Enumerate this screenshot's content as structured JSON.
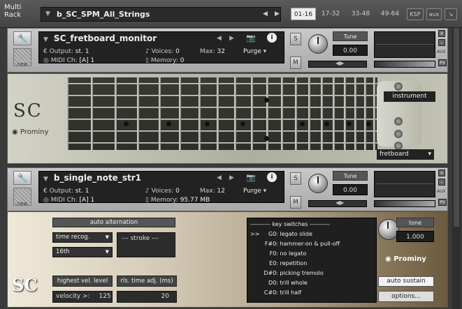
{
  "rack": {
    "label": "Multi Rack",
    "name": "b_SC_SPM_All_Strings",
    "tabs": [
      "01-16",
      "17-32",
      "33-48",
      "49-64"
    ],
    "active_tab": "01-16",
    "ksp_label": "KSP",
    "aux_label": "aux"
  },
  "instrument1": {
    "name": "SC_fretboard_monitor",
    "output_label": "Output:",
    "output": "st. 1",
    "voices_label": "Voices:",
    "voices": "0",
    "max_label": "Max:",
    "max": "32",
    "purge_label": "Purge",
    "midi_label": "MIDI Ch:",
    "midi": "[A]  1",
    "memory_label": "Memory:",
    "memory": "0",
    "tune_label": "Tune",
    "tune_value": "0.00",
    "solo": "S",
    "mute": "M"
  },
  "instrument2": {
    "name": "b_single_note_str1",
    "output_label": "Output:",
    "output": "st. 1",
    "voices_label": "Voices:",
    "voices": "0",
    "max_label": "Max:",
    "max": "12",
    "purge_label": "Purge",
    "midi_label": "MIDI Ch:",
    "midi": "[A]  1",
    "memory_label": "Memory:",
    "memory": "95.77 MB",
    "tune_label": "Tune",
    "tune_value": "0.00",
    "solo": "S",
    "mute": "M"
  },
  "side_labels": {
    "aux": "AUX",
    "pv": "PV",
    "new": "new"
  },
  "fretboard": {
    "logo_text": "SC",
    "brand": "Prominy",
    "instrument_label": "instrument",
    "view_select": "fretboard"
  },
  "controls": {
    "auto_alternation": "auto alternation",
    "time_recog": "time recog.",
    "note_value": "16th",
    "stroke": "--- stroke ---",
    "highest_vel_label": "highest vel. level",
    "rls_time_label": "rls. time adj. (ms)",
    "velocity_label": "velocity >:",
    "velocity_value": "125",
    "rls_time_value": "20",
    "tone_label": "tone",
    "tone_value": "1.000",
    "brand": "Prominy",
    "logo_text": "SC",
    "auto_sustain": "auto sustain",
    "options": "options..."
  },
  "key_switches": {
    "title": "---------- key switches ----------",
    "items": [
      {
        "marker": ">>",
        "key": "G0:",
        "label": "legato slide"
      },
      {
        "marker": "",
        "key": "F#0:",
        "label": "hammer-on & pull-off"
      },
      {
        "marker": "",
        "key": "F0:",
        "label": "no legato"
      },
      {
        "marker": "",
        "key": "E0:",
        "label": "repetition"
      },
      {
        "marker": "",
        "key": "D#0:",
        "label": "picking tremolo"
      },
      {
        "marker": "",
        "key": "D0:",
        "label": "trill whole"
      },
      {
        "marker": "",
        "key": "C#0:",
        "label": "trill half"
      }
    ]
  }
}
